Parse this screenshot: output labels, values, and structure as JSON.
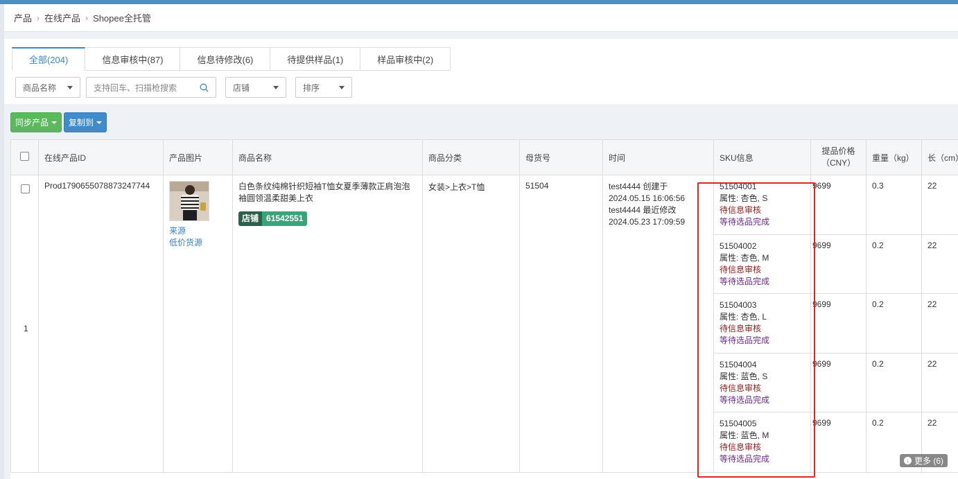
{
  "breadcrumb": [
    "产品",
    "在线产品",
    "Shopee全托管"
  ],
  "tabs": [
    {
      "label": "全部(204)",
      "active": true
    },
    {
      "label": "信息审核中(87)"
    },
    {
      "label": "信息待修改(6)"
    },
    {
      "label": "待提供样品(1)"
    },
    {
      "label": "样品审核中(2)"
    }
  ],
  "filters": {
    "name_select": "商品名称",
    "search_placeholder": "支持回车、扫描枪搜索",
    "shop_select": "店铺",
    "sort_select": "排序"
  },
  "actions": {
    "sync": "同步产品",
    "copy": "复制到"
  },
  "table": {
    "headers": [
      "在线产品ID",
      "产品图片",
      "商品名称",
      "商品分类",
      "母货号",
      "时间",
      "SKU信息",
      "提品价格（CNY）",
      "重量（kg）",
      "长（cm）"
    ],
    "row": {
      "index": "1",
      "id": "Prod1790655078873247744",
      "image_links": [
        "来源",
        "低价货源"
      ],
      "name": "白色条纹纯棉针织短袖T恤女夏季薄款正肩泡泡袖圆领温柔甜美上衣",
      "shop_label": "店铺",
      "shop_id": "61542551",
      "category": "女装>上衣>T恤",
      "parent_sku": "51504",
      "time_created": "test4444 创建于",
      "time_created_at": "2024.05.15 16:06:56",
      "time_modified": "test4444 最近修改",
      "time_modified_at": "2024.05.23 17:09:59",
      "skus": [
        {
          "code": "51504001",
          "attr": "属性: 杏色, S",
          "status1": "待信息审核",
          "status2": "等待选品完成",
          "price": "9699",
          "weight": "0.3",
          "length": "22"
        },
        {
          "code": "51504002",
          "attr": "属性: 杏色, M",
          "status1": "待信息审核",
          "status2": "等待选品完成",
          "price": "9699",
          "weight": "0.2",
          "length": "22"
        },
        {
          "code": "51504003",
          "attr": "属性: 杏色, L",
          "status1": "待信息审核",
          "status2": "等待选品完成",
          "price": "9699",
          "weight": "0.2",
          "length": "22"
        },
        {
          "code": "51504004",
          "attr": "属性: 蓝色, S",
          "status1": "待信息审核",
          "status2": "等待选品完成",
          "price": "9699",
          "weight": "0.2",
          "length": "22"
        },
        {
          "code": "51504005",
          "attr": "属性: 蓝色, M",
          "status1": "待信息审核",
          "status2": "等待选品完成",
          "price": "9699",
          "weight": "0.2",
          "length": "22"
        }
      ]
    }
  },
  "more_button": "更多 (6)",
  "colors": {
    "accent": "#3a87c8",
    "green": "#5cb85c",
    "blue": "#428bca",
    "highlight": "#e02424"
  }
}
